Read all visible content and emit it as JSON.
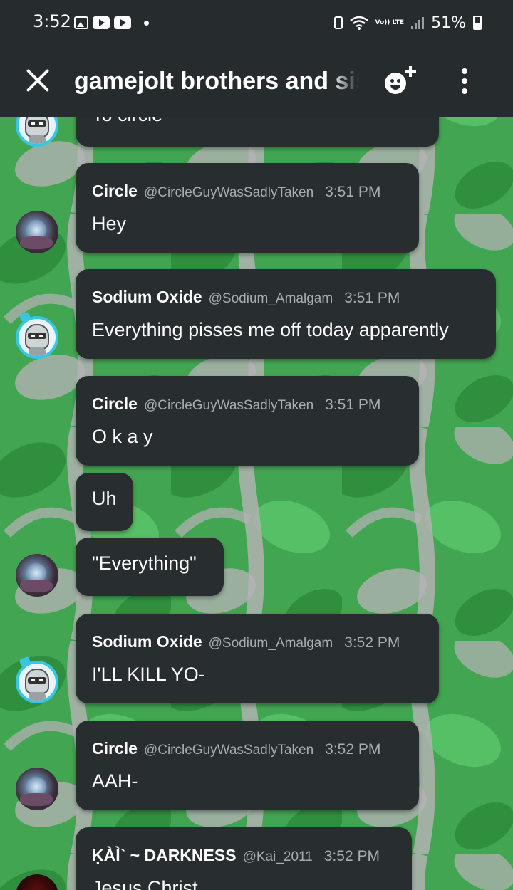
{
  "status_bar": {
    "time": "3:52",
    "network_label": "Vo)) LTE",
    "battery": "51%"
  },
  "app_bar": {
    "title": "gamejolt brothers and sisters"
  },
  "messages": [
    {
      "author": "",
      "handle": "",
      "time": "",
      "text": "To circle",
      "avatar": "sodium-oxide-avatar"
    },
    {
      "author": "Circle",
      "handle": "@CircleGuyWasSadlyTaken",
      "time": "3:51 PM",
      "text": "Hey",
      "avatar": "circle-avatar"
    },
    {
      "author": "Sodium Oxide",
      "handle": "@Sodium_Amalgam",
      "time": "3:51 PM",
      "text": "Everything pisses me off today apparently",
      "avatar": "sodium-oxide-avatar"
    },
    {
      "author": "Circle",
      "handle": "@CircleGuyWasSadlyTaken",
      "time": "3:51 PM",
      "text": "O k a y",
      "avatar": ""
    },
    {
      "author": "",
      "handle": "",
      "time": "",
      "text": "Uh",
      "avatar": ""
    },
    {
      "author": "",
      "handle": "",
      "time": "",
      "text": "\"Everything\"",
      "avatar": "circle-avatar"
    },
    {
      "author": "Sodium Oxide",
      "handle": "@Sodium_Amalgam",
      "time": "3:52 PM",
      "text": "I'LL KILL YO-",
      "avatar": "sodium-oxide-avatar"
    },
    {
      "author": "Circle",
      "handle": "@CircleGuyWasSadlyTaken",
      "time": "3:52 PM",
      "text": "AAH-",
      "avatar": "circle-avatar"
    },
    {
      "author": "ḲÀÌ` ~ DARKNESS",
      "handle": "@Kai_2011",
      "time": "3:52 PM",
      "text": "Jesus Christ",
      "avatar": "kai-avatar"
    }
  ],
  "colors": {
    "bar_background": "#262b2d",
    "bubble_background": "#282d2f",
    "pattern_green_dark": "#2f8f3f",
    "pattern_green_light": "#4fbf5f",
    "pattern_vine": "#b8b3b8",
    "secondary_text": "#a8adaf",
    "sodium_ring": "#38c6e4"
  },
  "icons": {
    "close": "close-icon",
    "add_friend": "add-friend-icon",
    "more": "more-vertical-icon"
  }
}
